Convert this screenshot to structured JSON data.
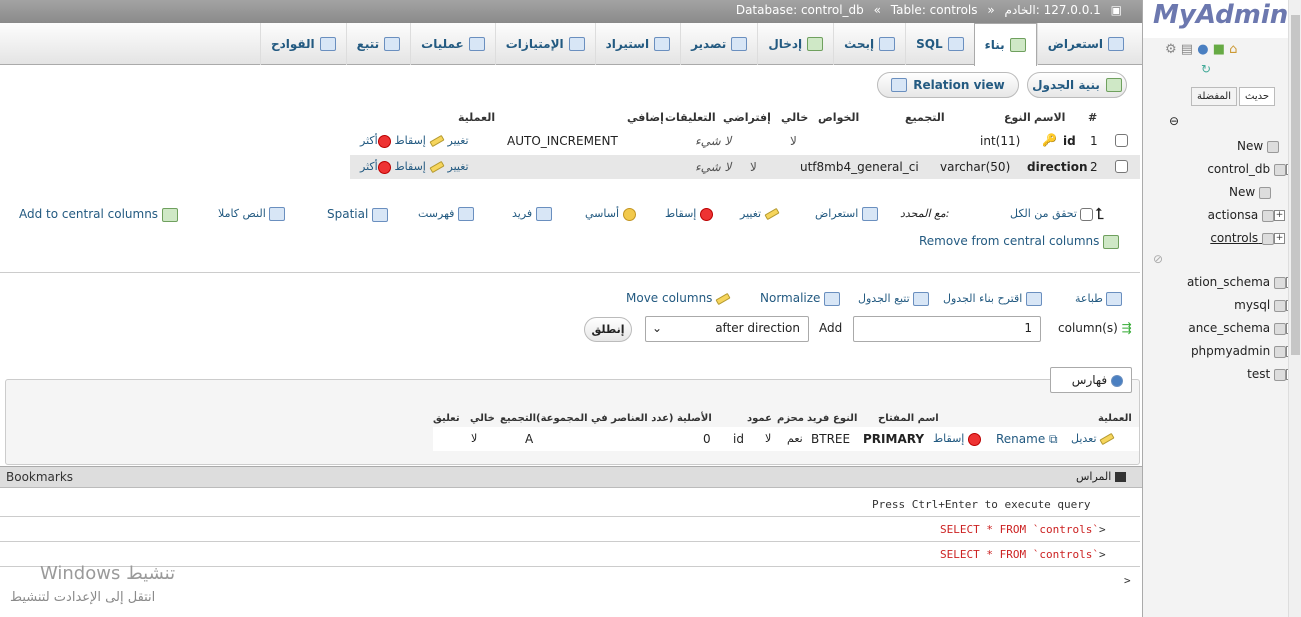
{
  "breadcrumb": {
    "server": "127.0.0.1 :الخادم",
    "database": "Database: control_db",
    "table": "Table: controls"
  },
  "tabs": [
    {
      "label": "استعراض",
      "icon": "browse-icon"
    },
    {
      "label": "بناء",
      "icon": "structure-icon",
      "active": true
    },
    {
      "label": "SQL",
      "icon": "sql-icon"
    },
    {
      "label": "إبحث",
      "icon": "search-icon"
    },
    {
      "label": "إدخال",
      "icon": "insert-icon"
    },
    {
      "label": "تصدير",
      "icon": "export-icon"
    },
    {
      "label": "استيراد",
      "icon": "import-icon"
    },
    {
      "label": "الإمتيازات",
      "icon": "privileges-icon"
    },
    {
      "label": "عمليات",
      "icon": "operations-icon"
    },
    {
      "label": "تتبع",
      "icon": "tracking-icon"
    },
    {
      "label": "القوادح",
      "icon": "triggers-icon"
    }
  ],
  "subtabs": {
    "table_structure": "بنية الجدول",
    "relation_view": "Relation view"
  },
  "columns_table": {
    "headers": [
      "#",
      "الاسم",
      "النوع",
      "التجميع",
      "الخواص",
      "خالي",
      "إفتراضي",
      "التعليقات",
      "إضافي",
      "العملية"
    ],
    "rows": [
      {
        "num": "1",
        "name": "id",
        "type": "int(11)",
        "collation": "",
        "null": "لا",
        "default": "لا شيء",
        "extra": "AUTO_INCREMENT",
        "change": "تغيير",
        "drop": "إسقاط",
        "more": "أكثر"
      },
      {
        "num": "2",
        "name": "direction",
        "type": "varchar(50)",
        "collation": "utf8mb4_general_ci",
        "null": "لا",
        "default": "لا شيء",
        "extra": "",
        "change": "تغيير",
        "drop": "إسقاط",
        "more": "أكثر"
      }
    ]
  },
  "bulk_actions": {
    "check_all": "تحقق من الكل",
    "with_selected": "مع المحدد:",
    "browse": "استعراض",
    "change": "تغيير",
    "drop": "إسقاط",
    "primary": "أساسي",
    "unique": "فريد",
    "index": "فهرست",
    "spatial": "Spatial",
    "fulltext": "النص كاملا",
    "add_central": "Add to central columns",
    "remove_central": "Remove from central columns"
  },
  "tools": {
    "print": "طباعة",
    "propose": "اقترح بناء الجدول",
    "track": "تتبع الجدول",
    "normalize": "Normalize",
    "move_columns": "Move columns"
  },
  "add_columns": {
    "add_label": "Add",
    "count": "1",
    "unit": "column(s)",
    "position": "after direction",
    "go": "إنطلق"
  },
  "indexes": {
    "title": "فهارس",
    "headers": [
      "العملية",
      "اسم المفتاح",
      "النوع",
      "فريد",
      "محزم",
      "عمود",
      "الأصلية (عدد العناصر في المجموعة)",
      "التجميع",
      "خالي",
      "تعليق"
    ],
    "row": {
      "edit": "تعديل",
      "rename": "Rename",
      "drop": "إسقاط",
      "keyname": "PRIMARY",
      "type": "BTREE",
      "unique": "نعم",
      "packed": "لا",
      "column": "id",
      "cardinality": "0",
      "collation": "A",
      "null": "لا",
      "comment": ""
    }
  },
  "console": {
    "title": "المراس",
    "bookmarks": "Bookmarks",
    "hint": "Press Ctrl+Enter to execute query",
    "queries": [
      "SELECT * FROM `controls`",
      "SELECT * FROM `controls`"
    ],
    "prompt": ">"
  },
  "watermark": {
    "line1": "تنشيط Windows",
    "line2": "انتقل إلى الإعدادت لتنشيط"
  },
  "sidebar": {
    "logo": "MyAdmin",
    "tabs": [
      "حديث",
      "المفضلة"
    ],
    "tree": [
      "New",
      "control_db",
      "New",
      "actionsa",
      "controls",
      "ation_schema",
      "mysql",
      "ance_schema",
      "phpmyadmin",
      "test"
    ]
  },
  "colors": {
    "link": "#235a81",
    "logo": "#6c78af",
    "breadcrumb": "#8a8a8a"
  }
}
